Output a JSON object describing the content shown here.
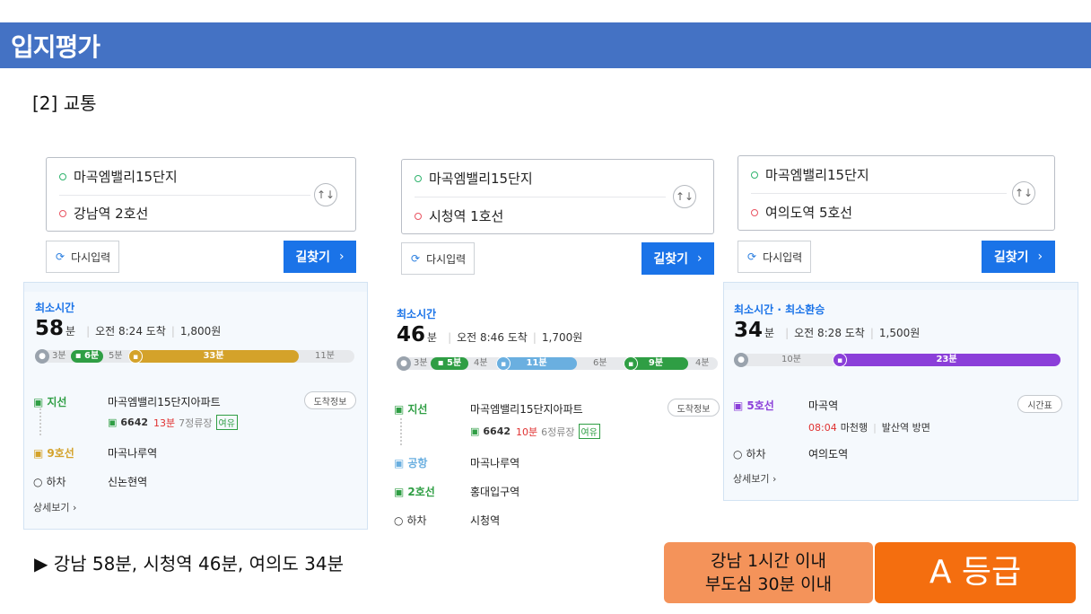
{
  "header": {
    "title": "입지평가"
  },
  "section": {
    "title": "[2] 교통"
  },
  "common": {
    "reset_label": "다시입력",
    "search_label": "길찾기",
    "chevron": "›",
    "more_label": "상세보기",
    "arrive_info_label": "도착정보",
    "timetable_label": "시간표",
    "swap_icon": "↑↓",
    "reset_icon": "refresh-icon"
  },
  "routes": [
    {
      "origin": "마곡엠밸리15단지",
      "destination": "강남역 2호선",
      "tag": "최소시간",
      "minutes": "58",
      "minutes_unit": "분",
      "arrival": "오전 8:24 도착",
      "fare": "1,800원",
      "bar": {
        "walk1": "3분",
        "bus": "6분",
        "wait": "5분",
        "train": "33분",
        "walk2": "11분",
        "train_color": "#d4a22a"
      },
      "legs": [
        {
          "name": "지선",
          "stop": "마곡엠밸리15단지아파트",
          "bus_no": "6642",
          "eta": "13분",
          "stops_left": "7정류장",
          "status": "여유"
        },
        {
          "name": "9호선",
          "stop": "마곡나루역"
        },
        {
          "name": "하차",
          "stop": "신논현역"
        }
      ]
    },
    {
      "origin": "마곡엠밸리15단지",
      "destination": "시청역 1호선",
      "tag": "최소시간",
      "minutes": "46",
      "minutes_unit": "분",
      "arrival": "오전 8:46 도착",
      "fare": "1,700원",
      "bar": {
        "walk1": "3분",
        "bus": "5분",
        "wait": "4분",
        "train": "11분",
        "transfer": "6분",
        "train2": "9분",
        "walk2": "4분",
        "train_color": "#6aafe0",
        "train2_color": "#2f9e44"
      },
      "legs": [
        {
          "name": "지선",
          "stop": "마곡엠밸리15단지아파트",
          "bus_no": "6642",
          "eta": "10분",
          "stops_left": "6정류장",
          "status": "여유"
        },
        {
          "name": "공항",
          "stop": "마곡나루역"
        },
        {
          "name": "2호선",
          "stop": "홍대입구역"
        },
        {
          "name": "하차",
          "stop": "시청역"
        }
      ]
    },
    {
      "origin": "마곡엠밸리15단지",
      "destination": "여의도역 5호선",
      "tag": "최소시간 · 최소환승",
      "minutes": "34",
      "minutes_unit": "분",
      "arrival": "오전 8:28 도착",
      "fare": "1,500원",
      "bar": {
        "walk1": "10분",
        "train": "23분",
        "train_color": "#8b3fd9"
      },
      "legs": [
        {
          "name": "5호선",
          "stop": "마곡역",
          "depart": "08:04",
          "direction": "마천행",
          "platform": "발산역 방면"
        },
        {
          "name": "하차",
          "stop": "여의도역"
        }
      ]
    }
  ],
  "summary": "▶ 강남 58분, 시청역 46분, 여의도 34분",
  "grade_note": {
    "line1": "강남 1시간 이내",
    "line2": "부도심 30분 이내"
  },
  "grade": "A 등급"
}
